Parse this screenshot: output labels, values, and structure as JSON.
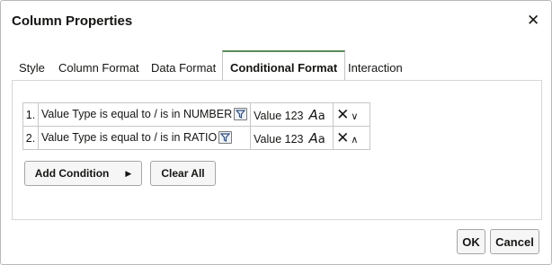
{
  "dialog": {
    "title": "Column Properties",
    "close_icon": "close-icon"
  },
  "tabs": [
    {
      "label": "Style",
      "active": false
    },
    {
      "label": "Column Format",
      "active": false
    },
    {
      "label": "Data Format",
      "active": false
    },
    {
      "label": "Conditional Format",
      "active": true
    },
    {
      "label": "Interaction",
      "active": false
    }
  ],
  "conditions": [
    {
      "number": "1.",
      "condition": "Value Type is equal to / is in NUMBER",
      "filter_icon": "filter-icon",
      "sample_value": "Value 123",
      "format_icon": "Aa",
      "delete_icon": "delete-icon",
      "move_icon": "chevron-down-icon",
      "move_glyph": "∨"
    },
    {
      "number": "2.",
      "condition": "Value Type is equal to / is in RATIO",
      "filter_icon": "filter-icon",
      "sample_value": "Value 123",
      "format_icon": "Aa",
      "delete_icon": "delete-icon",
      "move_icon": "chevron-up-icon",
      "move_glyph": "∧"
    }
  ],
  "actions": {
    "add_condition_label": "Add Condition",
    "clear_all_label": "Clear All"
  },
  "footer": {
    "ok_label": "OK",
    "cancel_label": "Cancel"
  },
  "colors": {
    "active_tab_accent": "#5b8a5b",
    "text": "#161513",
    "border": "#c7c7c7"
  }
}
